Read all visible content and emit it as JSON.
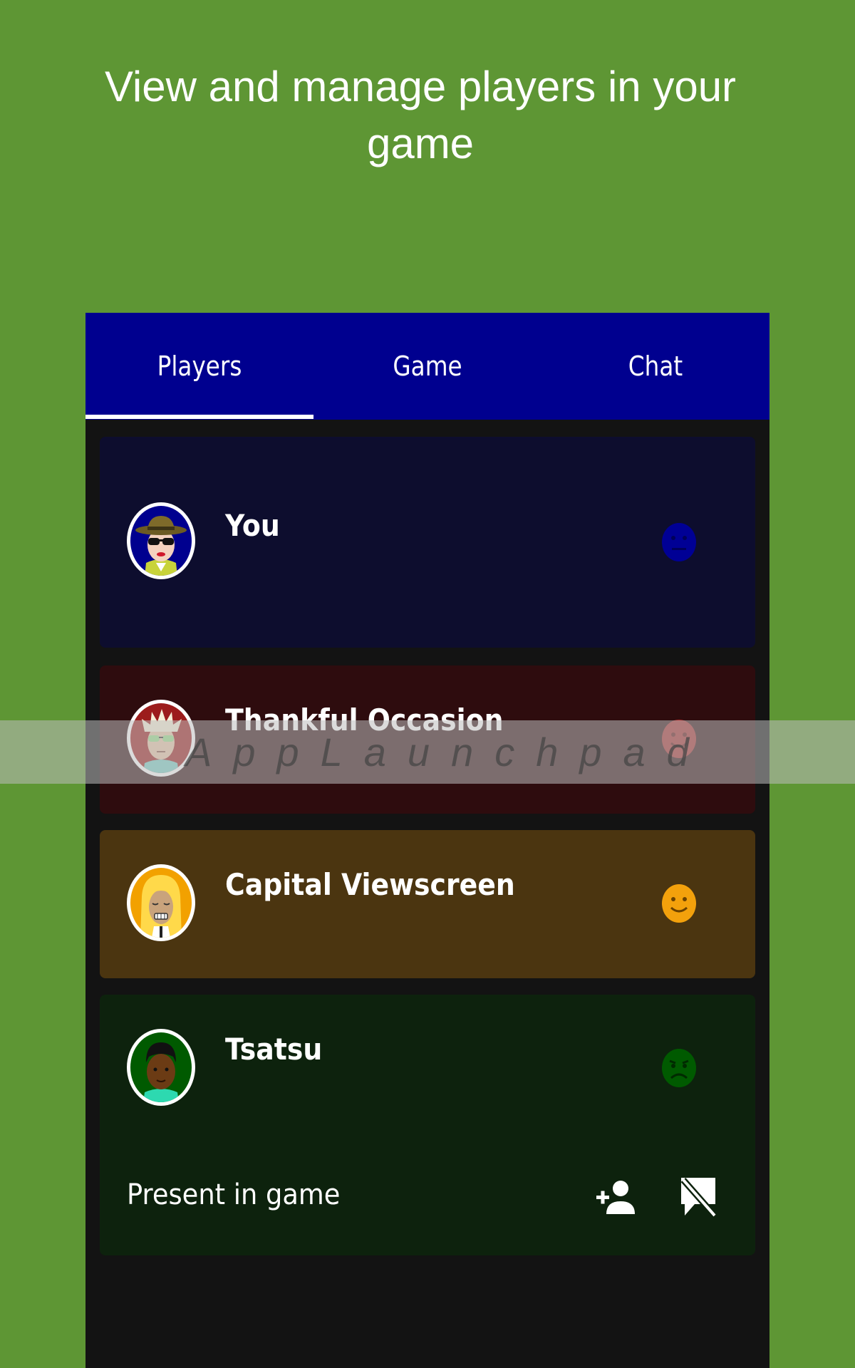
{
  "headline": "View and manage players in your game",
  "tabs": [
    {
      "label": "Players",
      "selected": true
    },
    {
      "label": "Game",
      "selected": false
    },
    {
      "label": "Chat",
      "selected": false
    }
  ],
  "players": [
    {
      "name": "You",
      "card_color": "#0d0d2e",
      "mood": "neutral-face-icon",
      "mood_color": "#000095",
      "avatar": "hat-sunglasses-avatar"
    },
    {
      "name": "Thankful Occasion",
      "card_color": "#2e0c0e",
      "mood": "smiling-face-icon",
      "mood_color": "#a32a2a",
      "avatar": "spiky-hair-avatar"
    },
    {
      "name": "Capital Viewscreen",
      "card_color": "#4b3510",
      "mood": "smiling-face-icon",
      "mood_color": "#f3a10c",
      "avatar": "blonde-hair-avatar"
    },
    {
      "name": "Tsatsu",
      "card_color": "#0d220d",
      "mood": "frowning-face-icon",
      "mood_color": "#005a00",
      "avatar": "dark-skin-avatar",
      "status": "Present in game",
      "actions": [
        "add-person-icon",
        "chat-off-icon"
      ]
    }
  ],
  "watermark": "AppLaunchpad",
  "colors": {
    "background": "#5e9634",
    "tabbar": "#00008f",
    "screen": "#131313"
  }
}
